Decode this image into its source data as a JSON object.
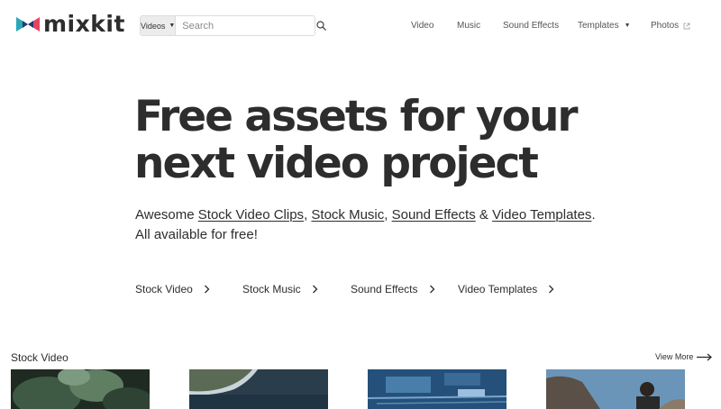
{
  "header": {
    "logo_text": "mixkit",
    "search": {
      "type_label": "Videos",
      "placeholder": "Search",
      "value": ""
    },
    "nav": [
      {
        "label": "Video"
      },
      {
        "label": "Music"
      },
      {
        "label": "Sound Effects"
      },
      {
        "label": "Templates",
        "has_dropdown": true
      },
      {
        "label": "Photos",
        "external": true
      }
    ]
  },
  "hero": {
    "title_line1": "Free assets for your",
    "title_line2": "next video project",
    "subtitle": {
      "prefix": "Awesome ",
      "links": [
        "Stock Video Clips",
        "Stock Music",
        "Sound Effects",
        "Video Templates"
      ],
      "sep_comma": ", ",
      "sep_and": " & ",
      "end": ".",
      "line2": "All available for free!"
    },
    "category_links": [
      "Stock Video",
      "Stock Music",
      "Sound Effects",
      "Video Templates"
    ]
  },
  "stock_video": {
    "title": "Stock Video",
    "view_more": "View More",
    "thumbnails": [
      "green-leaves-thumbnail",
      "coastline-aerial-thumbnail",
      "circuit-board-thumbnail",
      "person-outdoors-thumbnail"
    ]
  },
  "colors": {
    "text": "#2d2d2d",
    "logo_teal": "#2aa7b8",
    "logo_pink": "#e6445f",
    "logo_navy": "#233b6e"
  }
}
